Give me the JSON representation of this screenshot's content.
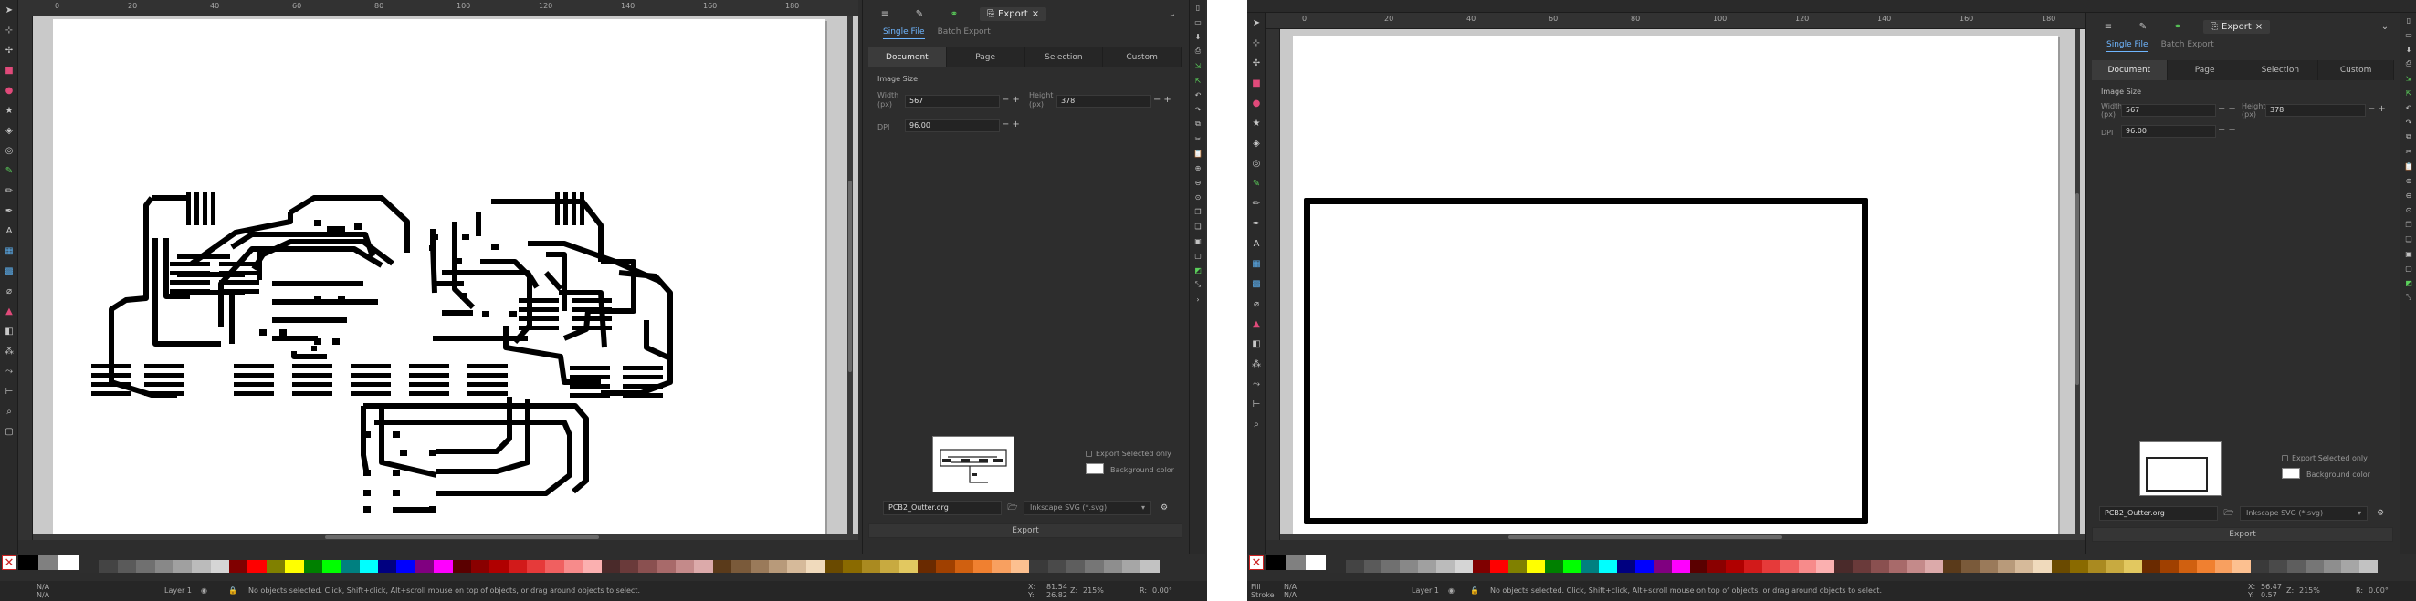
{
  "window_left": {
    "dock": {
      "export_tab_label": "Export",
      "close_glyph": "×",
      "single_file": "Single File",
      "batch_export": "Batch Export",
      "areas": [
        "Document",
        "Page",
        "Selection",
        "Custom"
      ],
      "image_size_label": "Image Size",
      "width_label": "Width",
      "width_unit": "(px)",
      "width_value": "567",
      "height_label": "Height",
      "height_unit": "(px)",
      "height_value": "378",
      "dpi_label": "DPI",
      "dpi_value": "96.00",
      "export_selected_only": "Export Selected only",
      "background_color": "Background color",
      "filename": "PCB2_Outter.org",
      "format": "Inkscape SVG (*.svg)",
      "export_button": "Export"
    },
    "status": {
      "layer": "Layer 1",
      "message": "No objects selected. Click, Shift+click, Alt+scroll mouse on top of objects, or drag around objects to select.",
      "x_label": "X:",
      "x_value": "81.54",
      "y_label": "Y:",
      "y_value": "26.82",
      "zoom_label": "Z:",
      "zoom_value": "215%",
      "rot_label": "R:",
      "rot_value": "0.00°",
      "fill_label": "N/A",
      "stroke_label": "N/A"
    }
  },
  "window_right": {
    "dock": {
      "export_tab_label": "Export",
      "close_glyph": "×",
      "single_file": "Single File",
      "batch_export": "Batch Export",
      "areas": [
        "Document",
        "Page",
        "Selection",
        "Custom"
      ],
      "image_size_label": "Image Size",
      "width_label": "Width",
      "width_unit": "(px)",
      "width_value": "567",
      "height_label": "Height",
      "height_unit": "(px)",
      "height_value": "378",
      "dpi_label": "DPI",
      "dpi_value": "96.00",
      "export_selected_only": "Export Selected only",
      "background_color": "Background color",
      "filename": "PCB2_Outter.org",
      "format": "Inkscape SVG (*.svg)",
      "export_button": "Export"
    },
    "status": {
      "layer": "Layer 1",
      "message": "No objects selected. Click, Shift+click, Alt+scroll mouse on top of objects, or drag around objects to select.",
      "x_label": "X:",
      "x_value": "56.47",
      "y_label": "Y:",
      "y_value": "0.57",
      "zoom_label": "Z:",
      "zoom_value": "215%",
      "rot_label": "R:",
      "rot_value": "0.00°",
      "fill_label": "N/A",
      "stroke_label": "N/A",
      "fill_title": "Fill",
      "stroke_title": "Stroke"
    }
  },
  "colors": {
    "ui_bg": "#2d2d2d",
    "accent": "#6fb6ff",
    "canvas": "#c9c9c9",
    "trace": "#000000"
  }
}
